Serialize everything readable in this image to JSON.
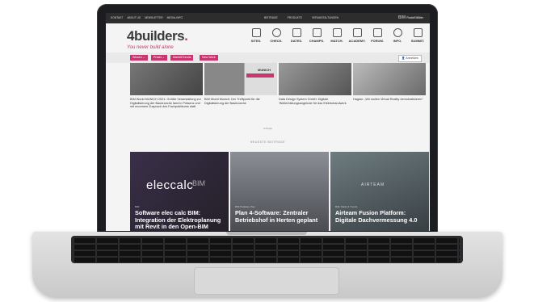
{
  "topbar": {
    "links": [
      "KONTAKT",
      "ABOUT US",
      "NEWSLETTER",
      "MEDIA-INFO"
    ],
    "center": [
      "BEITRÄGE",
      "PRODUKTE",
      "VERANSTALTUNGEN"
    ],
    "user_prefix": "BIM",
    "user": "Rudolf Müller"
  },
  "header": {
    "logo": "4builders",
    "logo_dot": ".",
    "tagline": "You never build alone",
    "nav": [
      "SITES.",
      "CHECK.",
      "DATES.",
      "CHAMPS.",
      "MATCH.",
      "ACADEMY.",
      "FORUM.",
      "INFO.",
      "SUMMIT."
    ]
  },
  "tabs": [
    "Wissen",
    "Praxis",
    "Markt&Trends",
    "New Work"
  ],
  "login": "Anmelden",
  "news": [
    {
      "caption": "BIM World MUNICH 2021: Größte Veranstaltung zur Digitalisierung der Baubranche fand in Präsenz und mit enormem Zuspruch des Fachpublikums statt"
    },
    {
      "caption": "BIM World Munich: Der Treffpunkt für die Digitalisierung der Baubranche"
    },
    {
      "caption": "Data Design System GmbH: Digitale 'Weiterbildungsangebote für das Elektrohandwerk"
    },
    {
      "caption": "Hagian: „Wir wollen Virtual Reality demokratisieren“"
    }
  ],
  "card2_overlay": "MUNICH",
  "anzeige": "Anzeige",
  "neueste": "NEUESTE BEITRÄGE",
  "featured": [
    {
      "kicker": "BIM",
      "title": "Software elec calc BIM: Integration der Elektroplanung mit Revit in den Open-BIM Prozess",
      "overlay": "eleccalc"
    },
    {
      "kicker": "BIM Praktiker, Bau",
      "title": "Plan 4-Software: Zentraler Betriebshof in Herten geplant",
      "overlay": ""
    },
    {
      "kicker": "BIM, Markt & Trends",
      "title": "Airteam Fusion Platform: Digitale Dachvermessung 4.0",
      "overlay": "AIRTEAM"
    }
  ],
  "colors": {
    "accent": "#c8356f",
    "topbar": "#2d2d2d"
  }
}
